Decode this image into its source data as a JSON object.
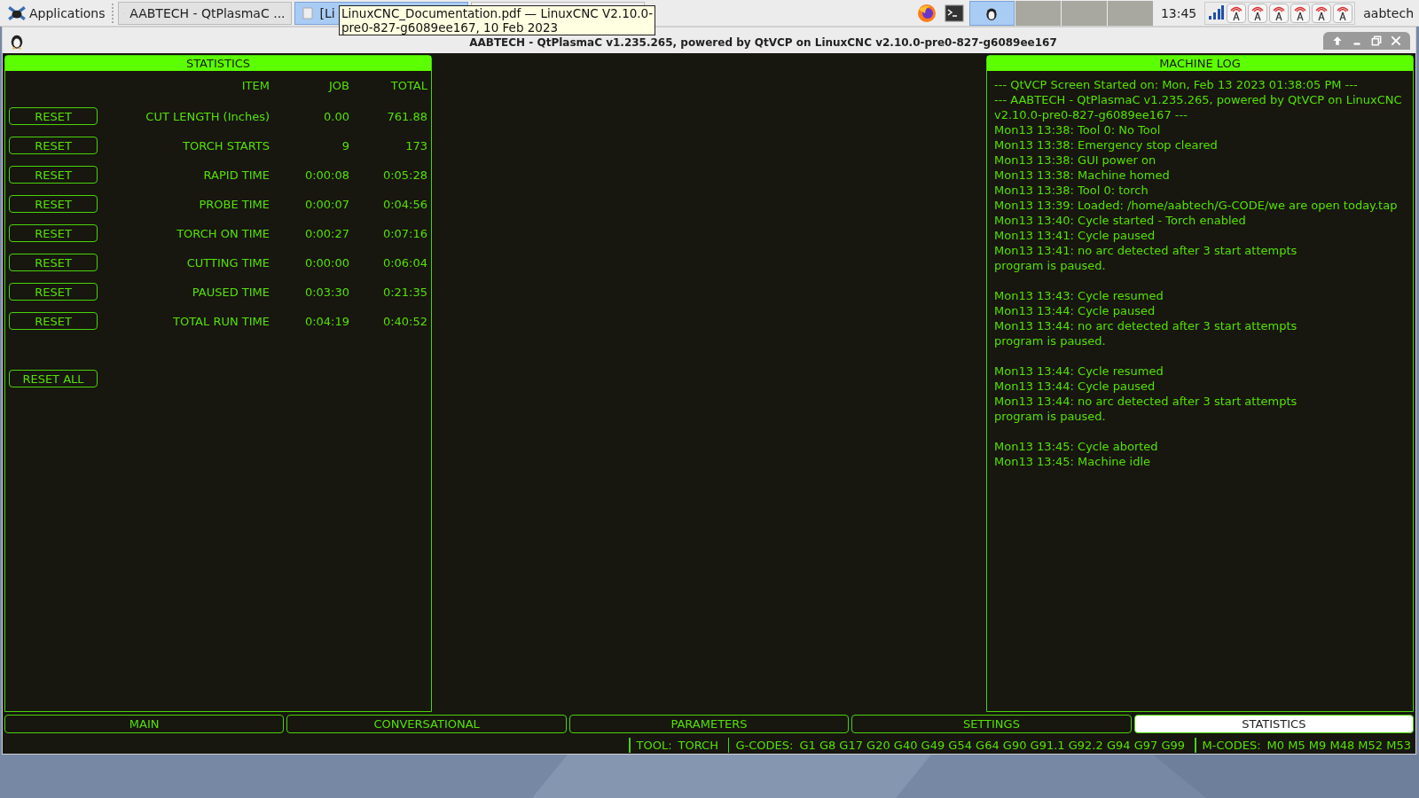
{
  "taskbar": {
    "menu_label": "Applications",
    "windows": [
      {
        "label": "AABTECH - QtPlasmaC ...",
        "selected": false
      },
      {
        "label": "[Li",
        "selected": true
      }
    ],
    "workspaces": [
      {
        "selected": true
      },
      {
        "selected": false
      },
      {
        "selected": false
      },
      {
        "selected": false
      }
    ],
    "clock": "13:45",
    "user": "aabtech"
  },
  "tooltip": {
    "text": "LinuxCNC_Documentation.pdf — LinuxCNC V2.10.0-\npre0-827-g6089ee167, 10 Feb 2023"
  },
  "window": {
    "title": "AABTECH - QtPlasmaC v1.235.265, powered by QtVCP on LinuxCNC v2.10.0-pre0-827-g6089ee167"
  },
  "statistics": {
    "title": "STATISTICS",
    "columns": [
      "ITEM",
      "JOB",
      "TOTAL"
    ],
    "rows": [
      {
        "button": "RESET",
        "item": "CUT LENGTH (Inches)",
        "job": "0.00",
        "total": "761.88"
      },
      {
        "button": "RESET",
        "item": "TORCH STARTS",
        "job": "9",
        "total": "173"
      },
      {
        "button": "RESET",
        "item": "RAPID TIME",
        "job": "0:00:08",
        "total": "0:05:28"
      },
      {
        "button": "RESET",
        "item": "PROBE TIME",
        "job": "0:00:07",
        "total": "0:04:56"
      },
      {
        "button": "RESET",
        "item": "TORCH ON TIME",
        "job": "0:00:27",
        "total": "0:07:16"
      },
      {
        "button": "RESET",
        "item": "CUTTING TIME",
        "job": "0:00:00",
        "total": "0:06:04"
      },
      {
        "button": "RESET",
        "item": "PAUSED TIME",
        "job": "0:03:30",
        "total": "0:21:35"
      },
      {
        "button": "RESET",
        "item": "TOTAL RUN TIME",
        "job": "0:04:19",
        "total": "0:40:52"
      }
    ],
    "reset_all": "RESET ALL"
  },
  "machine_log": {
    "title": "MACHINE LOG",
    "groups": [
      [
        "--- QtVCP Screen Started on: Mon, Feb 13 2023 01:38:05 PM ---",
        "--- AABTECH - QtPlasmaC v1.235.265, powered by QtVCP on LinuxCNC v2.10.0-pre0-827-g6089ee167 ---",
        "Mon13 13:38: Tool 0: No Tool",
        "Mon13 13:38: Emergency stop cleared",
        "Mon13 13:38: GUI power on",
        "Mon13 13:38: Machine homed",
        "Mon13 13:38: Tool 0: torch",
        "Mon13 13:39: Loaded: /home/aabtech/G-CODE/we are open today.tap",
        "Mon13 13:40: Cycle started - Torch enabled",
        "Mon13 13:41: Cycle paused",
        "Mon13 13:41: no arc detected after 3 start attempts",
        "program is paused."
      ],
      [
        "Mon13 13:43: Cycle resumed",
        "Mon13 13:44: Cycle paused",
        "Mon13 13:44: no arc detected after 3 start attempts",
        "program is paused."
      ],
      [
        "Mon13 13:44: Cycle resumed",
        "Mon13 13:44: Cycle paused",
        "Mon13 13:44: no arc detected after 3 start attempts",
        "program is paused."
      ],
      [
        "Mon13 13:45: Cycle aborted",
        "Mon13 13:45: Machine idle"
      ]
    ]
  },
  "tabs": [
    {
      "label": "MAIN",
      "selected": false
    },
    {
      "label": "CONVERSATIONAL",
      "selected": false
    },
    {
      "label": "PARAMETERS",
      "selected": false
    },
    {
      "label": "SETTINGS",
      "selected": false
    },
    {
      "label": "STATISTICS",
      "selected": true
    }
  ],
  "status_bar": {
    "tool_label": "TOOL:",
    "tool": "TORCH",
    "gcodes_label": "G-CODES:",
    "gcodes": "G1 G8 G17 G20 G40 G49 G54 G64 G90 G91.1 G92.2 G94 G97 G99",
    "mcodes_label": "M-CODES:",
    "mcodes": "M0 M5 M9 M48 M52 M53"
  }
}
